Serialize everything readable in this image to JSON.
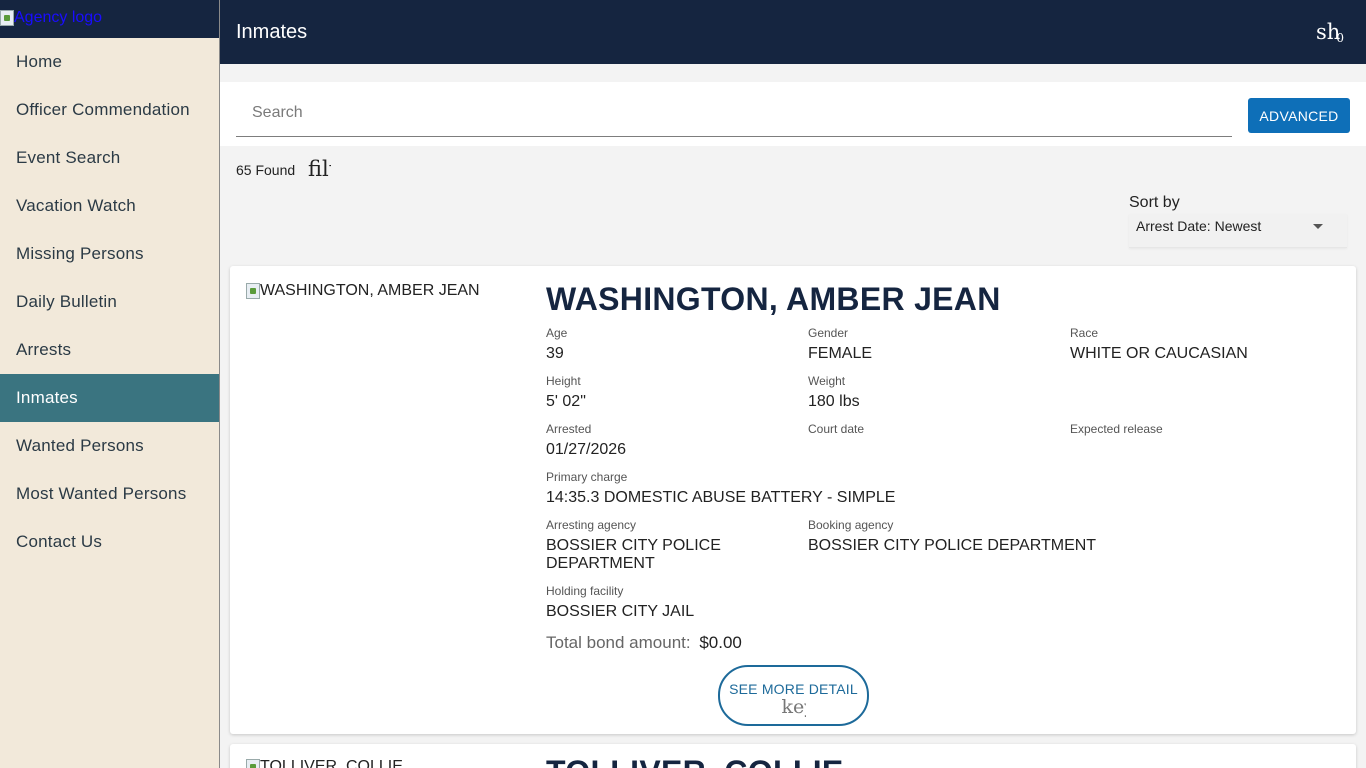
{
  "sidebar": {
    "logo_alt": "Agency logo",
    "items": [
      {
        "label": "Home",
        "active": false
      },
      {
        "label": "Officer Commendation",
        "active": false
      },
      {
        "label": "Event Search",
        "active": false
      },
      {
        "label": "Vacation Watch",
        "active": false
      },
      {
        "label": "Missing Persons",
        "active": false
      },
      {
        "label": "Daily Bulletin",
        "active": false
      },
      {
        "label": "Arrests",
        "active": false
      },
      {
        "label": "Inmates",
        "active": true
      },
      {
        "label": "Wanted Persons",
        "active": false
      },
      {
        "label": "Most Wanted Persons",
        "active": false
      },
      {
        "label": "Contact Us",
        "active": false
      }
    ]
  },
  "header": {
    "title": "Inmates",
    "right_icon_text": "shopping_cart",
    "badge": "0"
  },
  "search": {
    "placeholder": "Search",
    "value": "",
    "advanced_label": "ADVANCED"
  },
  "results": {
    "count_text": "65 Found",
    "filter_icon_text": "filter_list"
  },
  "sort": {
    "label": "Sort by",
    "selected": "Arrest Date: Newest"
  },
  "cards": [
    {
      "photo_alt": "WASHINGTON, AMBER JEAN",
      "name": "WASHINGTON, AMBER JEAN",
      "age_label": "Age",
      "age": "39",
      "gender_label": "Gender",
      "gender": "FEMALE",
      "race_label": "Race",
      "race": "WHITE OR CAUCASIAN",
      "height_label": "Height",
      "height": "5' 02\"",
      "weight_label": "Weight",
      "weight": "180 lbs",
      "arrested_label": "Arrested",
      "arrested": "01/27/2026",
      "court_label": "Court date",
      "court": "",
      "release_label": "Expected release",
      "release": "",
      "charge_label": "Primary charge",
      "charge": "14:35.3 DOMESTIC ABUSE BATTERY - SIMPLE",
      "arresting_label": "Arresting agency",
      "arresting": "BOSSIER CITY POLICE DEPARTMENT",
      "booking_label": "Booking agency",
      "booking": "BOSSIER CITY POLICE DEPARTMENT",
      "facility_label": "Holding facility",
      "facility": "BOSSIER CITY JAIL",
      "bond_label": "Total bond amount:",
      "bond": "$0.00",
      "details_label": "SEE MORE DETAIL",
      "details_icon_text": "keyboard_arrow_down"
    },
    {
      "photo_alt": "TOLLIVER, COLLIE",
      "name": "TOLLIVER, COLLIE"
    }
  ]
}
